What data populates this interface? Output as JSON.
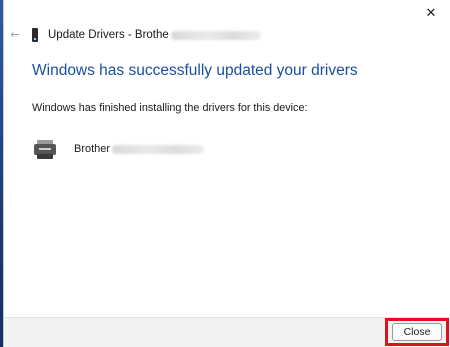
{
  "window": {
    "close_glyph": "✕",
    "back_glyph": "←",
    "title": "Update Drivers - Brothe"
  },
  "main": {
    "headline": "Windows has successfully updated your drivers",
    "message": "Windows has finished installing the drivers for this device:",
    "device": {
      "name": "Brother",
      "icon": "printer-icon"
    }
  },
  "footer": {
    "close_label": "Close"
  },
  "colors": {
    "headline": "#1c4fa0",
    "highlight": "#e01020",
    "desktop": "#1f3f7a"
  },
  "icons": [
    "close-icon",
    "back-arrow-icon",
    "device-icon",
    "printer-icon"
  ]
}
